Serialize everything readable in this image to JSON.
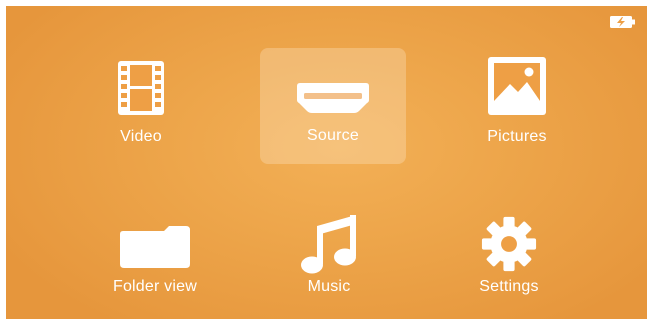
{
  "status": {
    "battery_icon": "battery-charging-icon"
  },
  "menu": {
    "selected": "Source",
    "items": [
      {
        "label": "Video",
        "icon": "film-icon"
      },
      {
        "label": "Source",
        "icon": "hdmi-icon"
      },
      {
        "label": "Pictures",
        "icon": "picture-icon"
      },
      {
        "label": "Folder view",
        "icon": "folder-icon"
      },
      {
        "label": "Music",
        "icon": "music-note-icon"
      },
      {
        "label": "Settings",
        "icon": "gear-icon"
      }
    ]
  },
  "colors": {
    "background": "#eda54a",
    "selection": "#f6c98e",
    "foreground": "#ffffff"
  }
}
